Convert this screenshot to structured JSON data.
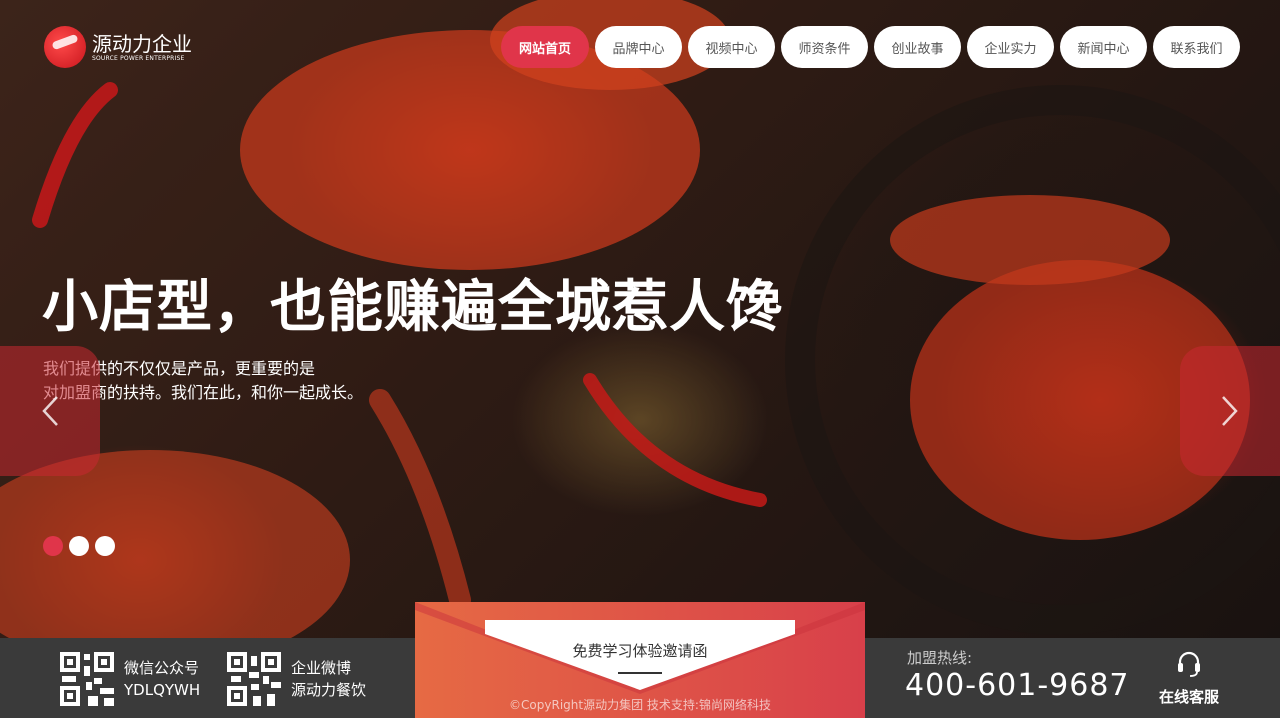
{
  "brand": {
    "name_cn": "源动力企业",
    "name_en": "SOURCE POWER ENTERPRISE"
  },
  "nav": {
    "items": [
      {
        "label": "网站首页",
        "active": true
      },
      {
        "label": "品牌中心"
      },
      {
        "label": "视频中心"
      },
      {
        "label": "师资条件"
      },
      {
        "label": "创业故事"
      },
      {
        "label": "企业实力"
      },
      {
        "label": "新闻中心"
      },
      {
        "label": "联系我们"
      }
    ]
  },
  "hero": {
    "headline": "小店型，也能赚遍全城惹人馋",
    "sub_line1": "我们提供的不仅仅是产品，更重要的是",
    "sub_line2": "对加盟商的扶持。我们在此，和你一起成长。",
    "slides_total": 3,
    "active_slide": 1
  },
  "footer": {
    "wechat": {
      "label": "微信公众号",
      "id": "YDLQYWH"
    },
    "weibo": {
      "label": "企业微博",
      "id": "源动力餐饮"
    },
    "promo": "免费学习体验邀请函",
    "copyright": "©CopyRight源动力集团 技术支持:锦尚网络科技",
    "hotline_label": "加盟热线:",
    "hotline": "400-601-9687",
    "service_label": "在线客服"
  },
  "colors": {
    "accent": "#e0354a",
    "footer_bg": "#3a3a3a"
  },
  "icons": [
    "logo-icon",
    "chevron-left-icon",
    "chevron-right-icon",
    "qr-code-icon",
    "headset-icon"
  ]
}
